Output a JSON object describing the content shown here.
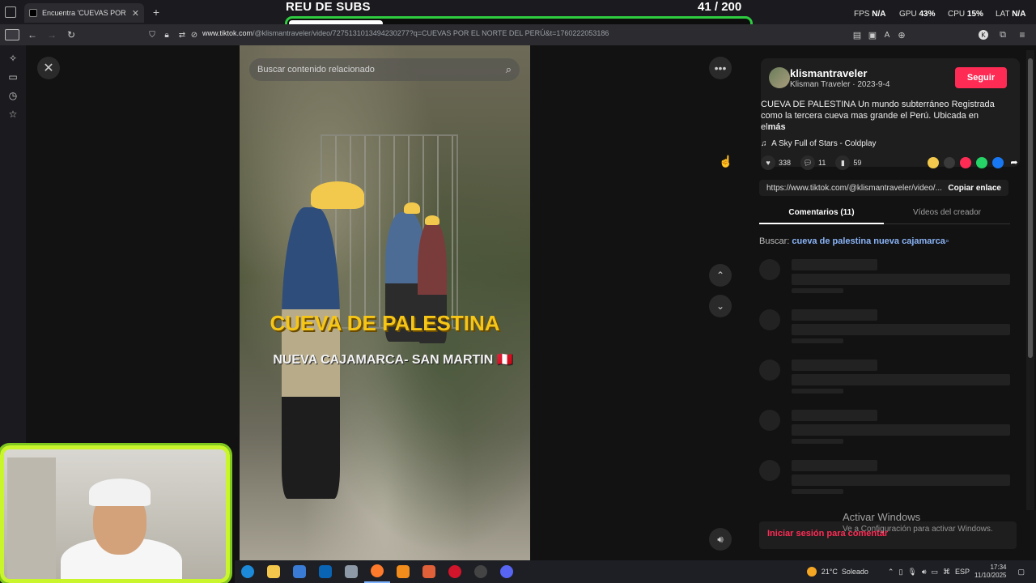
{
  "browser": {
    "tab_title": "Encuentra 'CUEVAS POR EL",
    "url_domain": "www.tiktok.com",
    "url_path": "/@klismantraveler/video/7275131013494230277?q=CUEVAS POR EL NORTE DEL PERÚ&t=1760222053186"
  },
  "overlay": {
    "title": "REU DE SUBS",
    "count_current": "41",
    "count_separator": " / ",
    "count_goal": "200",
    "progress": 0.205,
    "colors": {
      "border": "#2ecc40",
      "fill": "#ffffff"
    }
  },
  "stats": {
    "fps_label": "FPS",
    "fps_value": "N/A",
    "gpu_label": "GPU",
    "gpu_value": "43",
    "cpu_label": "CPU",
    "cpu_value": "15",
    "lat_label": "LAT",
    "lat_value": "N/A"
  },
  "video": {
    "search_placeholder": "Buscar contenido relacionado",
    "title_main": "CUEVA DE PALESTINA",
    "title_sub": "NUEVA CAJAMARCA- SAN MARTIN 🇵🇪"
  },
  "post": {
    "username": "klismantraveler",
    "display_name": "Klisman Traveler",
    "date": "2023-9-4",
    "follow_label": "Seguir",
    "description": "CUEVA DE PALESTINA Un mundo subterráneo Registrada como la tercera cueva mas grande el Perú. Ubicada en el",
    "more_label": "más",
    "music": "A Sky Full of Stars - Coldplay",
    "likes": "338",
    "comments": "11",
    "saves": "59",
    "link": "https://www.tiktok.com/@klismantraveler/video/...",
    "copy_label": "Copiar enlace",
    "tab_comments": "Comentarios (11)",
    "tab_creator": "Vídeos del creador",
    "related_label": "Buscar:",
    "related_query": "cueva de palestina nueva cajamarca",
    "login_label": "Iniciar sesión para comentar",
    "accent": "#fe2c55"
  },
  "windows": {
    "activate_title": "Activar Windows",
    "activate_sub": "Ve a Configuración para activar Windows.",
    "weather": "21°C  Soleado",
    "lang": "ESP",
    "time": "17:34",
    "date": "11/10/2025"
  }
}
